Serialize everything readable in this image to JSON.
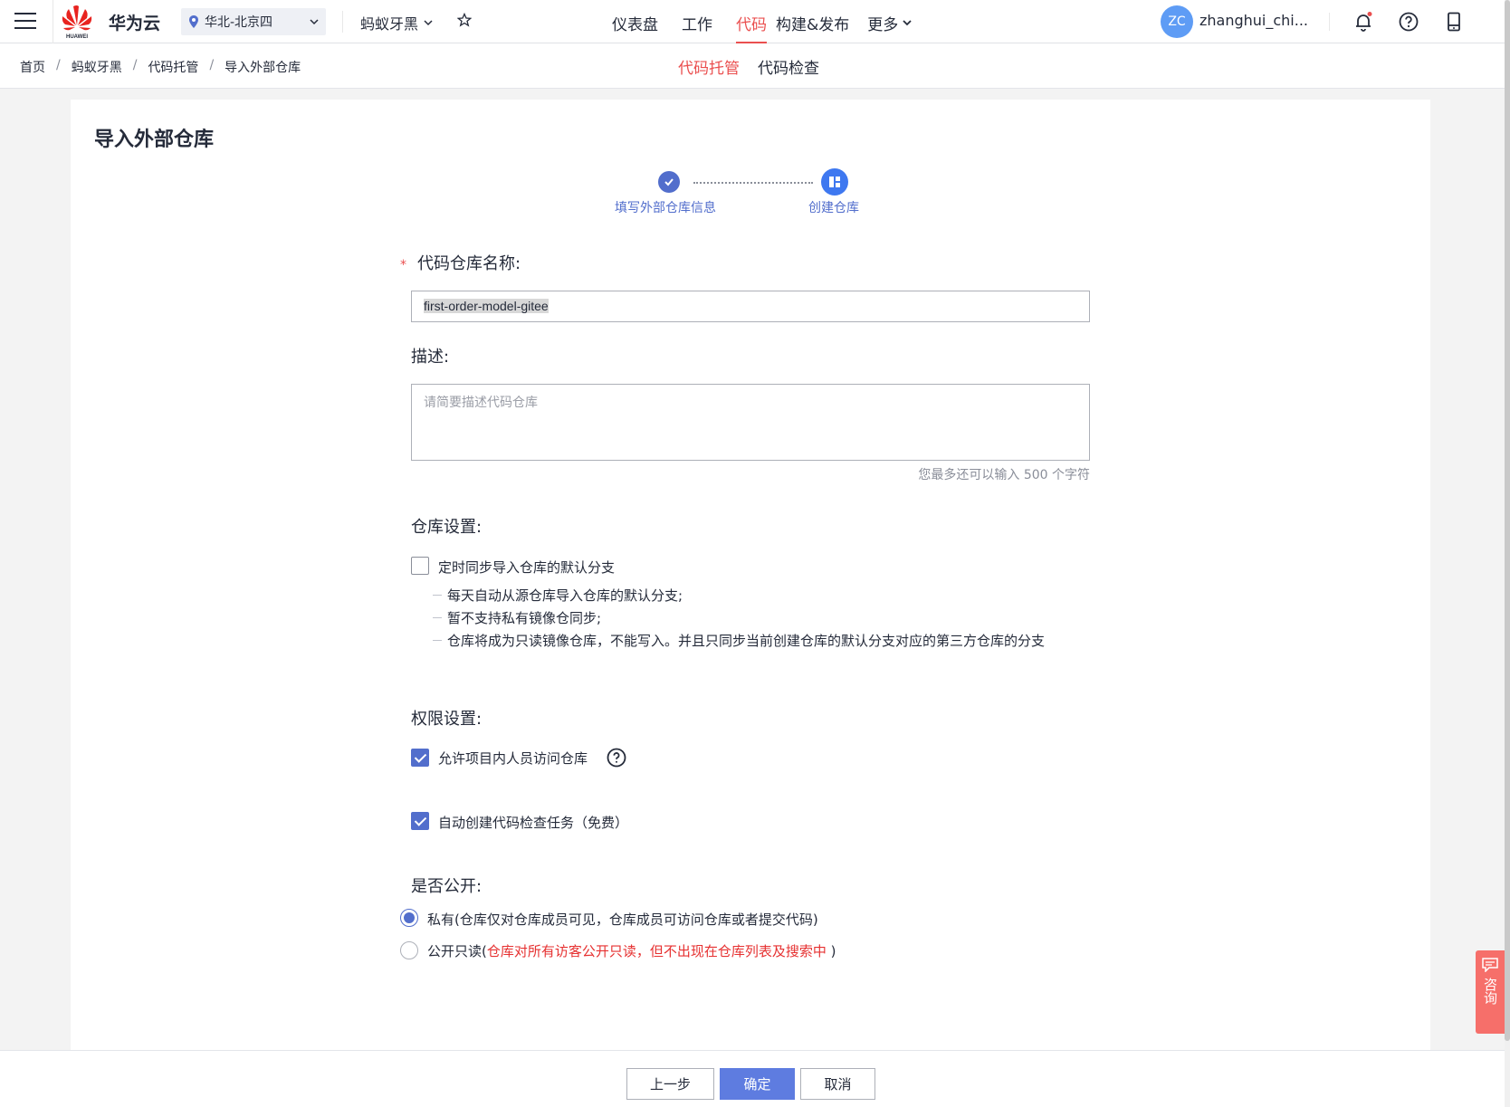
{
  "topbar": {
    "brand": "华为云",
    "logo_text": "HUAWEI",
    "region": "华北-北京四",
    "project": "蚂蚁牙黑",
    "nav": [
      {
        "label": "仪表盘"
      },
      {
        "label": "工作"
      },
      {
        "label": "代码"
      },
      {
        "label": "构建&发布"
      },
      {
        "label": "更多"
      }
    ],
    "active_nav": "代码",
    "avatar_initials": "ZC",
    "username": "zhanghui_chi...",
    "accent_color": "#ea4f4f"
  },
  "breadcrumb": [
    "首页",
    "蚂蚁牙黑",
    "代码托管",
    "导入外部仓库"
  ],
  "subtabs": [
    "代码托管",
    "代码检查"
  ],
  "page": {
    "title": "导入外部仓库",
    "steps": [
      {
        "label": "填写外部仓库信息",
        "status": "done"
      },
      {
        "label": "创建仓库",
        "status": "current"
      }
    ],
    "repo_name_label": "代码仓库名称:",
    "repo_name_value": "first-order-model-gitee",
    "desc_label": "描述:",
    "desc_placeholder": "请简要描述代码仓库",
    "desc_counter": "您最多还可以输入 500 个字符",
    "repo_settings_label": "仓库设置:",
    "sync_checkbox_label": "定时同步导入仓库的默认分支",
    "sync_checked": false,
    "sync_notes": [
      "每天自动从源仓库导入仓库的默认分支;",
      "暂不支持私有镜像仓同步;",
      "仓库将成为只读镜像仓库，不能写入。并且只同步当前创建仓库的默认分支对应的第三方仓库的分支"
    ],
    "perm_label": "权限设置:",
    "allow_members_label": "允许项目内人员访问仓库",
    "allow_members_checked": true,
    "auto_check_label": "自动创建代码检查任务（免费）",
    "auto_check_checked": true,
    "public_label": "是否公开:",
    "visibility_options": [
      {
        "label": "私有(仓库仅对仓库成员可见，仓库成员可访问仓库或者提交代码)",
        "checked": true
      },
      {
        "label_prefix": "公开只读(",
        "label_warn": "仓库对所有访客公开只读，但不出现在仓库列表及搜索中",
        "label_suffix": " )",
        "checked": false
      }
    ]
  },
  "footer": {
    "prev_label": "上一步",
    "confirm_label": "确定",
    "cancel_label": "取消"
  },
  "consult": {
    "label": "咨询"
  }
}
